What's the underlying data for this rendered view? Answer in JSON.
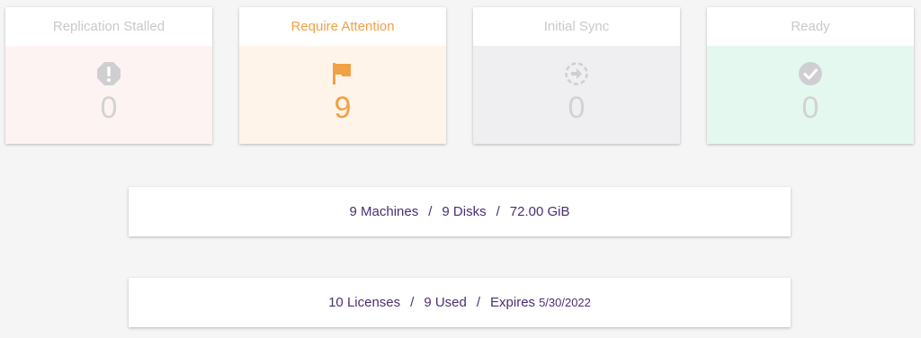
{
  "cards": [
    {
      "label": "Replication Stalled",
      "count": "0",
      "icon": "exclamation-octagon-icon",
      "color": "#d0d0d0",
      "bg": "#fdf3f2"
    },
    {
      "label": "Require Attention",
      "count": "9",
      "icon": "flag-icon",
      "color": "#f0a145",
      "bg": "#fef4ea"
    },
    {
      "label": "Initial Sync",
      "count": "0",
      "icon": "sync-arrow-icon",
      "color": "#d0d0d0",
      "bg": "#efeff1"
    },
    {
      "label": "Ready",
      "count": "0",
      "icon": "check-circle-icon",
      "color": "#d0d0d0",
      "bg": "#e5f8ef"
    }
  ],
  "summary": {
    "machines": "9 Machines",
    "disks": "9 Disks",
    "size": "72.00 GiB",
    "separator": "/"
  },
  "licenses": {
    "total": "10 Licenses",
    "used": "9 Used",
    "expires_label": "Expires",
    "expires_date": "5/30/2022",
    "separator": "/"
  },
  "colors": {
    "accent_orange": "#f0a145",
    "text_purple": "#4a2f73",
    "muted": "#c9c9c9"
  }
}
